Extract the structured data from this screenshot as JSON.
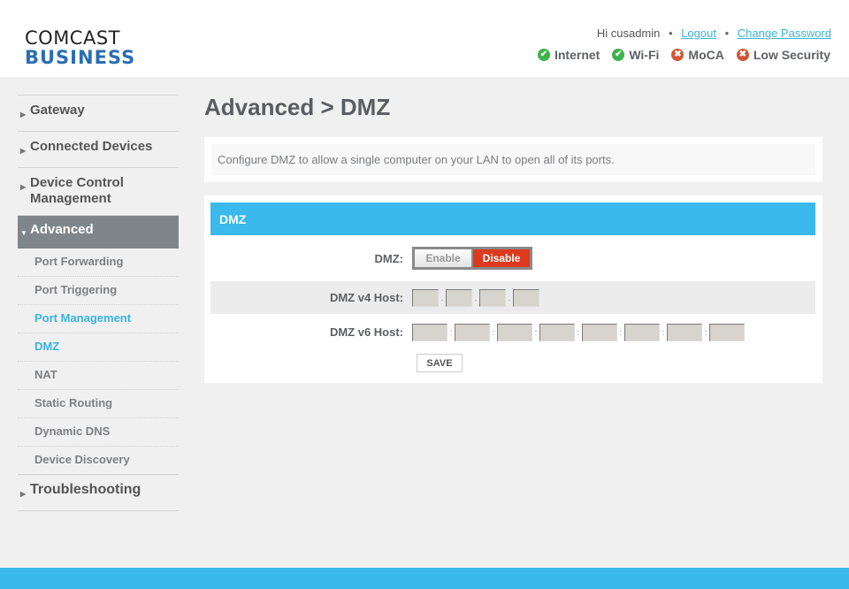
{
  "brand": {
    "line1": "COMCAST",
    "line2": "BUSINESS"
  },
  "user": {
    "greeting": "Hi cusadmin",
    "logout": "Logout",
    "change_password": "Change Password",
    "separator": "•"
  },
  "status": [
    {
      "label": "Internet",
      "state": "ok",
      "glyph": "✔"
    },
    {
      "label": "Wi-Fi",
      "state": "ok",
      "glyph": "✔"
    },
    {
      "label": "MoCA",
      "state": "error",
      "glyph": "✖"
    },
    {
      "label": "Low Security",
      "state": "error",
      "glyph": "✖"
    }
  ],
  "sidebar": {
    "items": [
      {
        "label": "Gateway",
        "arrow": "▶"
      },
      {
        "label": "Connected Devices",
        "arrow": "▶"
      },
      {
        "label": "Device Control Management",
        "arrow": "▶"
      },
      {
        "label": "Advanced",
        "arrow": "▼",
        "active": true
      },
      {
        "label": "Troubleshooting",
        "arrow": "▶"
      }
    ],
    "advanced_sub": [
      {
        "label": "Port Forwarding"
      },
      {
        "label": "Port Triggering"
      },
      {
        "label": "Port Management",
        "highlighted": true
      },
      {
        "label": "DMZ",
        "current": true
      },
      {
        "label": "NAT"
      },
      {
        "label": "Static Routing"
      },
      {
        "label": "Dynamic DNS"
      },
      {
        "label": "Device Discovery"
      }
    ]
  },
  "main": {
    "title": "Advanced > DMZ",
    "intro": "Configure DMZ to allow a single computer on your LAN to open all of its ports.",
    "section_title": "DMZ",
    "dmz_label": "DMZ:",
    "enable_label": "Enable",
    "disable_label": "Disable",
    "dmz_state": "Disable",
    "v4_label": "DMZ v4 Host:",
    "v4_octets": [
      "",
      "",
      "",
      ""
    ],
    "v4_sep": ".",
    "v6_label": "DMZ v6 Host:",
    "v6_groups": [
      "",
      "",
      "",
      "",
      "",
      "",
      "",
      ""
    ],
    "v6_sep": ":",
    "save_label": "SAVE"
  },
  "colors": {
    "accent": "#3ab9ec",
    "active_nav": "#7f868b",
    "disable_red": "#dd3a1d",
    "ok_green": "#3db34a",
    "error_red": "#d25535",
    "brand_blue": "#2a6db4"
  }
}
